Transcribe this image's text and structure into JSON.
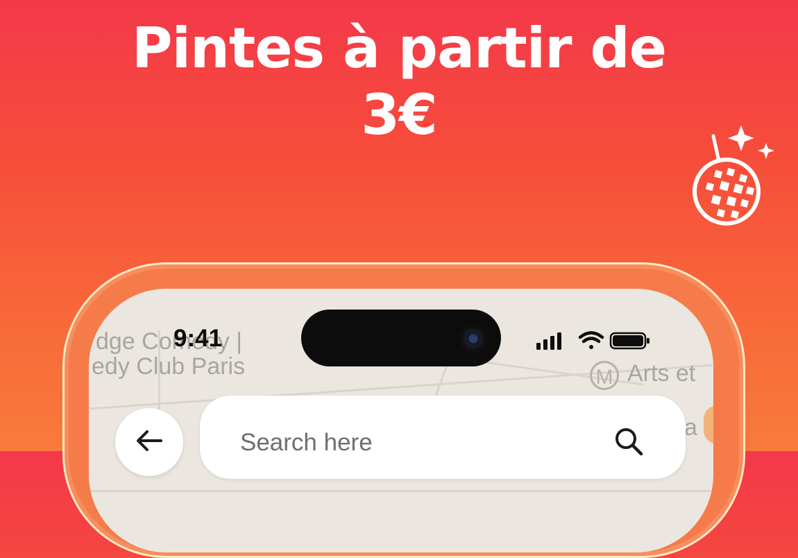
{
  "promo": {
    "headline_line1": "Pintes à partir de",
    "headline_line2": "3€"
  },
  "status_bar": {
    "time": "9:41"
  },
  "map": {
    "label_1_line1": "dge Comedy |",
    "label_1_line2": "edy Club Paris",
    "metro_letter": "M",
    "metro_label": "Arts et",
    "edge_label": "a"
  },
  "search": {
    "placeholder": "Search here"
  },
  "icons": {
    "disco": "disco-ball-icon",
    "back": "arrow-left-icon",
    "search": "search-icon",
    "signal": "cellular-signal-icon",
    "wifi": "wifi-icon",
    "battery": "battery-icon"
  },
  "colors": {
    "background_top": "#f4384a",
    "background_bottom": "#f97a3b",
    "frame": "#f57b4a",
    "frame_outline": "#ffe9c4"
  }
}
